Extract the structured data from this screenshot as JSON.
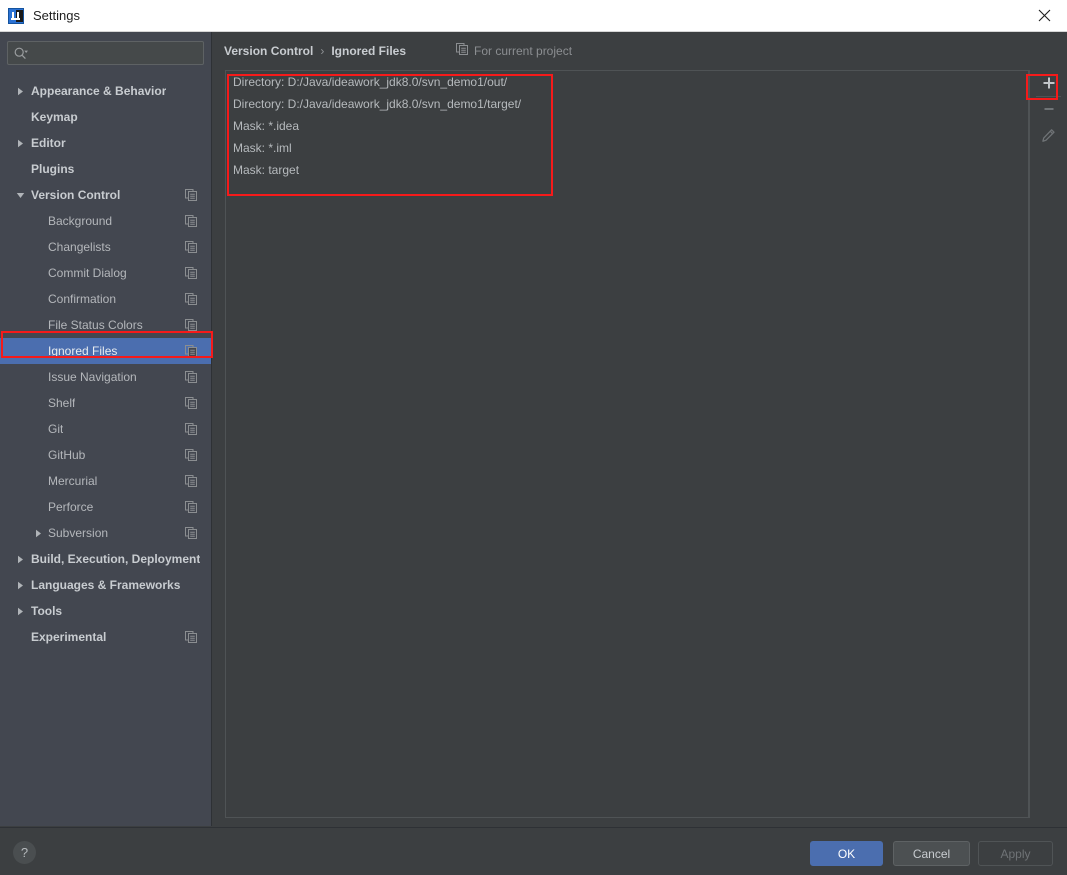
{
  "window": {
    "title": "Settings",
    "logo_icon": "intellij-idea-logo",
    "close_icon": "close-icon"
  },
  "search": {
    "placeholder": "",
    "value": "",
    "icon": "search-icon",
    "dropdown_icon": "chevron-down-icon"
  },
  "sidebar": {
    "items": [
      {
        "label": "Appearance & Behavior",
        "level": "top",
        "arrow": "collapsed",
        "scope_icon": false
      },
      {
        "label": "Keymap",
        "level": "top",
        "arrow": "none",
        "scope_icon": false
      },
      {
        "label": "Editor",
        "level": "top",
        "arrow": "collapsed",
        "scope_icon": false
      },
      {
        "label": "Plugins",
        "level": "top",
        "arrow": "none",
        "scope_icon": false
      },
      {
        "label": "Version Control",
        "level": "top",
        "arrow": "expanded",
        "scope_icon": true
      },
      {
        "label": "Background",
        "level": "sub",
        "arrow": "none",
        "scope_icon": true
      },
      {
        "label": "Changelists",
        "level": "sub",
        "arrow": "none",
        "scope_icon": true
      },
      {
        "label": "Commit Dialog",
        "level": "sub",
        "arrow": "none",
        "scope_icon": true
      },
      {
        "label": "Confirmation",
        "level": "sub",
        "arrow": "none",
        "scope_icon": true
      },
      {
        "label": "File Status Colors",
        "level": "sub",
        "arrow": "none",
        "scope_icon": true
      },
      {
        "label": "Ignored Files",
        "level": "sub",
        "arrow": "none",
        "scope_icon": true,
        "selected": true
      },
      {
        "label": "Issue Navigation",
        "level": "sub",
        "arrow": "none",
        "scope_icon": true
      },
      {
        "label": "Shelf",
        "level": "sub",
        "arrow": "none",
        "scope_icon": true
      },
      {
        "label": "Git",
        "level": "sub",
        "arrow": "none",
        "scope_icon": true
      },
      {
        "label": "GitHub",
        "level": "sub",
        "arrow": "none",
        "scope_icon": true
      },
      {
        "label": "Mercurial",
        "level": "sub",
        "arrow": "none",
        "scope_icon": true
      },
      {
        "label": "Perforce",
        "level": "sub",
        "arrow": "none",
        "scope_icon": true
      },
      {
        "label": "Subversion",
        "level": "sub",
        "arrow": "collapsed",
        "scope_icon": true
      },
      {
        "label": "Build, Execution, Deployment",
        "level": "top",
        "arrow": "collapsed",
        "scope_icon": false
      },
      {
        "label": "Languages & Frameworks",
        "level": "top",
        "arrow": "collapsed",
        "scope_icon": false
      },
      {
        "label": "Tools",
        "level": "top",
        "arrow": "collapsed",
        "scope_icon": false
      },
      {
        "label": "Experimental",
        "level": "top",
        "arrow": "none",
        "scope_icon": true
      }
    ]
  },
  "content": {
    "breadcrumb": {
      "parent": "Version Control",
      "separator": "›",
      "current": "Ignored Files"
    },
    "scope_note": {
      "icon": "project-scope-icon",
      "label": "For current project"
    },
    "ignored_files": [
      "Directory: D:/Java/ideawork_jdk8.0/svn_demo1/out/",
      "Directory: D:/Java/ideawork_jdk8.0/svn_demo1/target/",
      "Mask: *.idea",
      "Mask: *.iml",
      "Mask: target"
    ],
    "toolbar": [
      {
        "name": "add-button",
        "icon": "plus-icon",
        "enabled": true
      },
      {
        "name": "remove-button",
        "icon": "minus-icon",
        "enabled": false
      },
      {
        "name": "edit-button",
        "icon": "pencil-icon",
        "enabled": false
      }
    ]
  },
  "footer": {
    "help_label": "?",
    "ok_label": "OK",
    "cancel_label": "Cancel",
    "apply_label": "Apply"
  },
  "colors": {
    "accent_blue": "#4b6eaf",
    "annotation_red": "#f61a1a",
    "sidebar_bg": "#434750",
    "content_bg": "#3c3f41",
    "titlebar_bg": "#ffffff"
  }
}
